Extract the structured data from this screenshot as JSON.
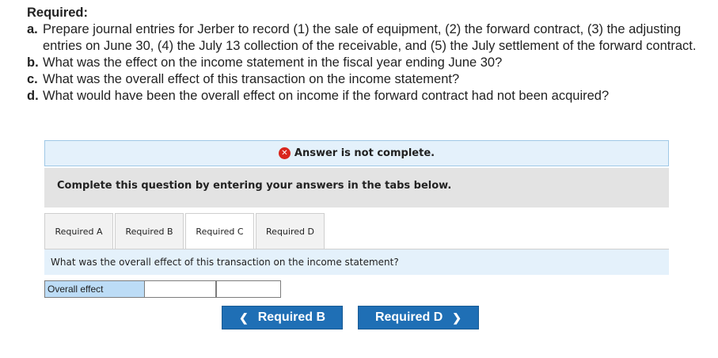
{
  "required": {
    "heading": "Required:",
    "items": [
      {
        "letter": "a.",
        "text": "Prepare journal entries for Jerber to record (1) the sale of equipment, (2) the forward contract, (3) the adjusting entries on June 30, (4) the July 13 collection of the receivable, and (5) the July settlement of the forward contract."
      },
      {
        "letter": "b.",
        "text": "What was the effect on the income statement in the fiscal year ending June 30?"
      },
      {
        "letter": "c.",
        "text": "What was the overall effect of this transaction on the income statement?"
      },
      {
        "letter": "d.",
        "text": "What would have been the overall effect on income if the forward contract had not been acquired?"
      }
    ]
  },
  "status": {
    "icon": "x-circle-icon",
    "text": "Answer is not complete.",
    "icon_color": "#d9251c"
  },
  "instruction": "Complete this question by entering your answers in the tabs below.",
  "tabs": [
    {
      "label": "Required A",
      "active": false
    },
    {
      "label": "Required B",
      "active": false
    },
    {
      "label": "Required C",
      "active": true
    },
    {
      "label": "Required D",
      "active": false
    }
  ],
  "question": "What was the overall effect of this transaction on the income statement?",
  "answer": {
    "label": "Overall effect",
    "value": "",
    "select_value": ""
  },
  "nav": {
    "prev_label": "Required B",
    "next_label": "Required D",
    "prev_icon": "chevron-left-icon",
    "next_icon": "chevron-right-icon",
    "button_color": "#1f6fb5"
  }
}
